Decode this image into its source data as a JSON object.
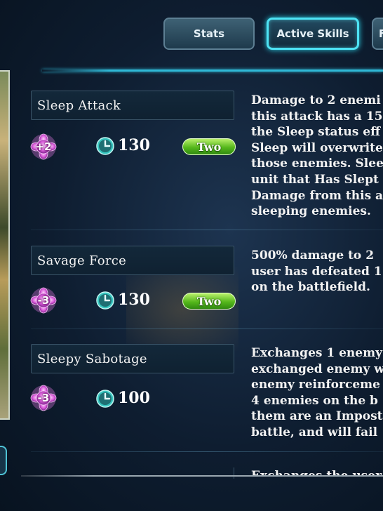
{
  "tabs": [
    {
      "label": "Stats",
      "active": false
    },
    {
      "label": "Active Skills",
      "active": true
    },
    {
      "label": "F",
      "active": false
    }
  ],
  "skills": [
    {
      "name": "Sleep Attack",
      "level_badge": "+2",
      "cost": "130",
      "target": "Two",
      "description": [
        "Damage to 2 enemi",
        "this attack has a 15",
        "the Sleep status eff",
        "Sleep will overwrite",
        "those enemies. Slee",
        "unit that Has Slept",
        "Damage from this a",
        "sleeping enemies."
      ]
    },
    {
      "name": "Savage Force",
      "level_badge": "-3",
      "cost": "130",
      "target": "Two",
      "description": [
        "500% damage to 2",
        "user has defeated 1",
        "on the battlefield."
      ]
    },
    {
      "name": "Sleepy Sabotage",
      "level_badge": "-3",
      "cost": "100",
      "target": "",
      "description": [
        "Exchanges 1 enemy",
        "exchanged enemy w",
        "enemy reinforceme",
        "4 enemies on the b",
        "them are an Impost",
        "battle, and will fail"
      ]
    }
  ],
  "next_description_partial": "Exchanges the user",
  "colors": {
    "accent": "#4ee3f4",
    "badge": "#d85bd8",
    "target_green": "#56b81c",
    "clock": "#37c6c0"
  },
  "icons": {
    "cost": "clock-icon",
    "badge": "flower-badge-icon"
  }
}
